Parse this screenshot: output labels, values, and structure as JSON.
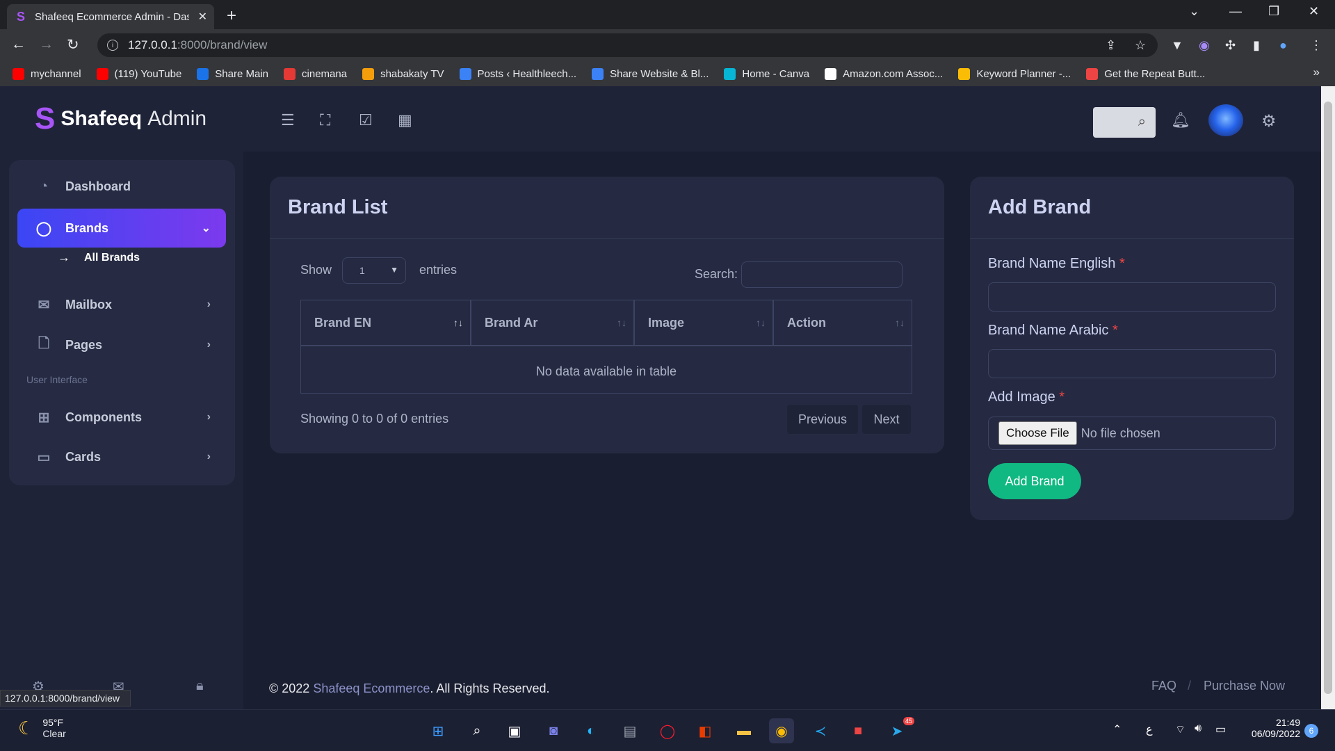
{
  "browser": {
    "tab_title": "Shafeeq Ecommerce Admin - Das",
    "url_host": "127.0.0.1",
    "url_path": ":8000/brand/view",
    "status_url": "127.0.0.1:8000/brand/view",
    "bookmarks": [
      {
        "label": "mychannel",
        "color": "#ff0000"
      },
      {
        "label": "(119) YouTube",
        "color": "#ff0000"
      },
      {
        "label": "Share Main",
        "color": "#1a73e8"
      },
      {
        "label": "cinemana",
        "color": "#e53935"
      },
      {
        "label": "shabakaty TV",
        "color": "#f59e0b"
      },
      {
        "label": "Posts ‹ Healthleech...",
        "color": "#3b82f6"
      },
      {
        "label": "Share Website & Bl...",
        "color": "#3b82f6"
      },
      {
        "label": "Home - Canva",
        "color": "#06b6d4"
      },
      {
        "label": "Amazon.com Assoc...",
        "color": "#ffffff"
      },
      {
        "label": "Keyword Planner -...",
        "color": "#fbbc05"
      },
      {
        "label": "Get the Repeat Butt...",
        "color": "#ef4444"
      }
    ]
  },
  "header": {
    "brand_bold": "Shafeeq",
    "brand_light": "Admin"
  },
  "sidebar": {
    "items": [
      {
        "label": "Dashboard",
        "icon": "pie-chart-icon"
      },
      {
        "label": "Brands",
        "icon": "chat-icon"
      },
      {
        "label": "Mailbox",
        "icon": "mail-icon"
      },
      {
        "label": "Pages",
        "icon": "file-icon"
      },
      {
        "label": "Components",
        "icon": "grid-icon"
      },
      {
        "label": "Cards",
        "icon": "card-icon"
      }
    ],
    "sub_item": "All Brands",
    "section_label": "User Interface"
  },
  "brand_list": {
    "title": "Brand List",
    "show_label": "Show",
    "entries_value": "1",
    "entries_label": "entries",
    "search_label": "Search:",
    "columns": [
      "Brand EN",
      "Brand Ar",
      "Image",
      "Action"
    ],
    "empty_text": "No data available in table",
    "info_text": "Showing 0 to 0 of 0 entries",
    "prev_label": "Previous",
    "next_label": "Next"
  },
  "add_brand": {
    "title": "Add Brand",
    "name_en_label": "Brand Name English",
    "name_ar_label": "Brand Name Arabic",
    "image_label": "Add Image",
    "required_mark": "*",
    "choose_file_label": "Choose File",
    "file_status": "No file chosen",
    "submit_label": "Add Brand"
  },
  "footer": {
    "copyright_prefix": "© 2022",
    "company": "Shafeeq Ecommerce",
    "rights": ". All Rights Reserved.",
    "faq": "FAQ",
    "separator": "/",
    "purchase": "Purchase Now"
  },
  "taskbar": {
    "temperature": "95°F",
    "condition": "Clear",
    "time": "21:49",
    "date": "06/09/2022",
    "notification_count": "6",
    "telegram_badge": "45",
    "lang": "ع"
  },
  "colors": {
    "accent_gradient_start": "#3b46f4",
    "accent_gradient_end": "#7c3aed",
    "success": "#10b981",
    "required": "#ef4444"
  }
}
